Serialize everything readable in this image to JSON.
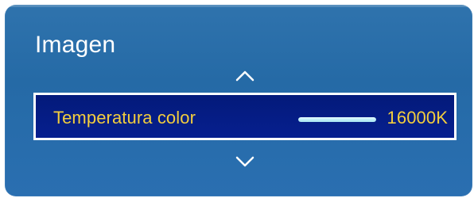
{
  "menu": {
    "title": "Imagen"
  },
  "selected_item": {
    "label": "Temperatura color",
    "value": "16000K",
    "slider_fraction": 1.0
  },
  "icons": {
    "up": "chevron-up-icon",
    "down": "chevron-down-icon"
  },
  "colors": {
    "panel_bg": "#2f73ad",
    "selected_bg": "#061f8f",
    "selected_text": "#f3ce3d",
    "slider_fill": "#bfeff8",
    "title_text": "#ffffff"
  }
}
